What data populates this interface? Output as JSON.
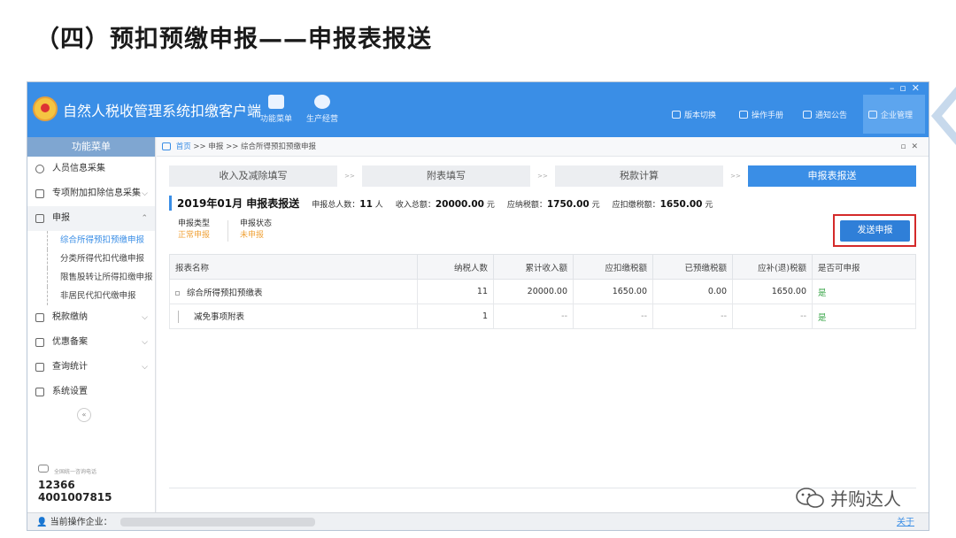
{
  "slide": {
    "title": "（四）预扣预缴申报——申报表报送"
  },
  "window": {
    "app_name": "自然人税收管理系统扣缴客户端",
    "toolbar": [
      {
        "label": "功能菜单",
        "icon": "wallet-icon"
      },
      {
        "label": "生产经营",
        "icon": "coins-icon"
      }
    ],
    "right_links": [
      {
        "label": "版本切换",
        "icon": "switch-icon"
      },
      {
        "label": "操作手册",
        "icon": "manual-icon"
      },
      {
        "label": "通知公告",
        "icon": "mail-icon"
      },
      {
        "label": "企业管理",
        "icon": "building-icon"
      }
    ]
  },
  "sidebar": {
    "header": "功能菜单",
    "items": [
      {
        "label": "人员信息采集",
        "icon": "person-icon",
        "has_chevron": false
      },
      {
        "label": "专项附加扣除信息采集",
        "icon": "list-icon",
        "has_chevron": true
      },
      {
        "label": "申报",
        "icon": "grid-icon",
        "has_chevron": true,
        "expanded": true
      }
    ],
    "sub_items": [
      {
        "label": "综合所得预扣预缴申报",
        "active": true
      },
      {
        "label": "分类所得代扣代缴申报",
        "active": false
      },
      {
        "label": "限售股转让所得扣缴申报",
        "active": false
      },
      {
        "label": "非居民代扣代缴申报",
        "active": false
      }
    ],
    "items_after": [
      {
        "label": "税款缴纳",
        "icon": "grid-icon",
        "has_chevron": true
      },
      {
        "label": "优惠备案",
        "icon": "doc-icon",
        "has_chevron": true
      },
      {
        "label": "查询统计",
        "icon": "grid-icon",
        "has_chevron": true
      },
      {
        "label": "系统设置",
        "icon": "grid-icon",
        "has_chevron": false
      }
    ],
    "collapse_glyph": "«",
    "hotline_label": "全国统一咨询电话",
    "hotline_numbers": [
      "12366",
      "4001007815"
    ]
  },
  "breadcrumb": {
    "home": "首页",
    "sep": ">>",
    "level1": "申报",
    "level2": "综合所得预扣预缴申报"
  },
  "steps": [
    "收入及减除填写",
    "附表填写",
    "税款计算",
    "申报表报送"
  ],
  "step_sep": ">>",
  "current_step": 3,
  "report": {
    "title": "2019年01月 申报表报送",
    "total_people_label": "申报总人数：",
    "total_people": "11",
    "total_people_unit": "人",
    "total_income_label": "收入总额：",
    "total_income": "20000.00",
    "total_income_unit": "元",
    "tax_payable_label": "应纳税额：",
    "tax_payable": "1750.00",
    "tax_payable_unit": "元",
    "withheld_label": "应扣缴税额：",
    "withheld": "1650.00",
    "withheld_unit": "元"
  },
  "meta": {
    "type_label": "申报类型",
    "type_value": "正常申报",
    "status_label": "申报状态",
    "status_value": "未申报"
  },
  "send_button": "发送申报",
  "table": {
    "headers": [
      "报表名称",
      "纳税人数",
      "累计收入额",
      "应扣缴税额",
      "已预缴税额",
      "应补(退)税额",
      "是否可申报"
    ],
    "rows": [
      [
        "综合所得预扣预缴表",
        "11",
        "20000.00",
        "1650.00",
        "0.00",
        "1650.00",
        "是"
      ],
      [
        "减免事项附表",
        "1",
        "--",
        "--",
        "--",
        "--",
        "是"
      ]
    ]
  },
  "statusbar": {
    "label": "当前操作企业：",
    "about": "关于"
  },
  "watermark": {
    "text": "并购达人"
  },
  "colors": {
    "titlebar": "#3a8ee6",
    "accent": "#3a8ee6",
    "highlight_border": "#d42a2a",
    "status_value": "#f0a33a",
    "yes": "#3aa64a"
  }
}
